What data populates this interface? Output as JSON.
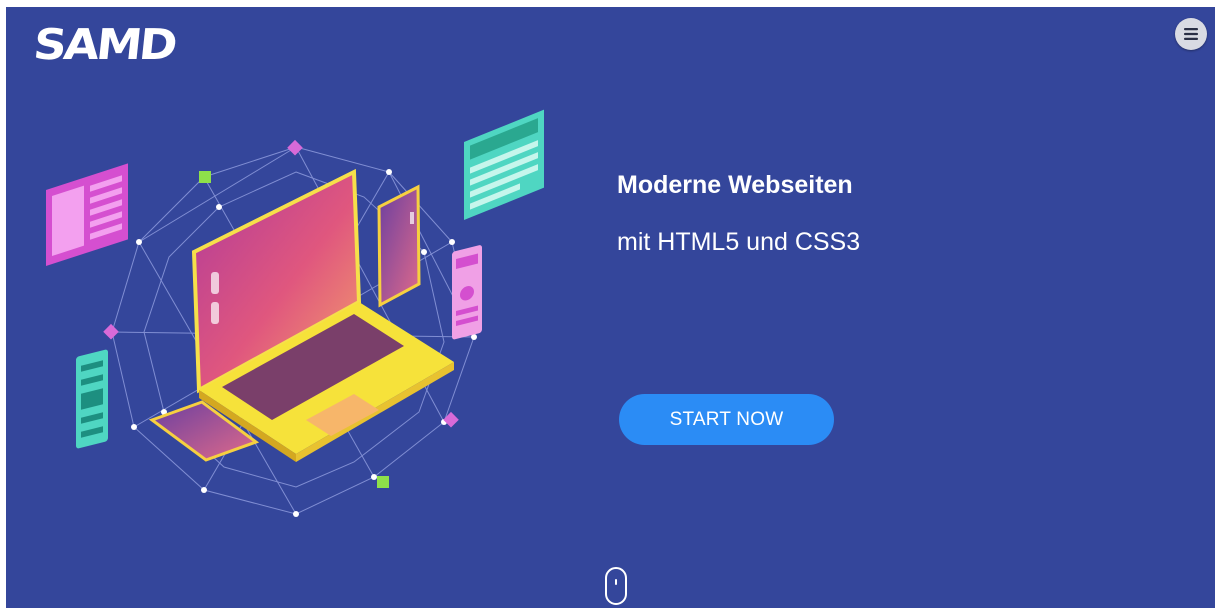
{
  "header": {
    "logo_text": "SAMD",
    "menu_icon": "hamburger-icon"
  },
  "hero": {
    "headline": "Moderne Webseiten",
    "subline": "mit HTML5 und CSS3",
    "cta_label": "START NOW",
    "illustration": "laptop-network-illustration",
    "scroll_icon": "mouse-scroll-icon"
  },
  "colors": {
    "background": "#34469b",
    "cta": "#2b8cf5",
    "text": "#ffffff"
  }
}
